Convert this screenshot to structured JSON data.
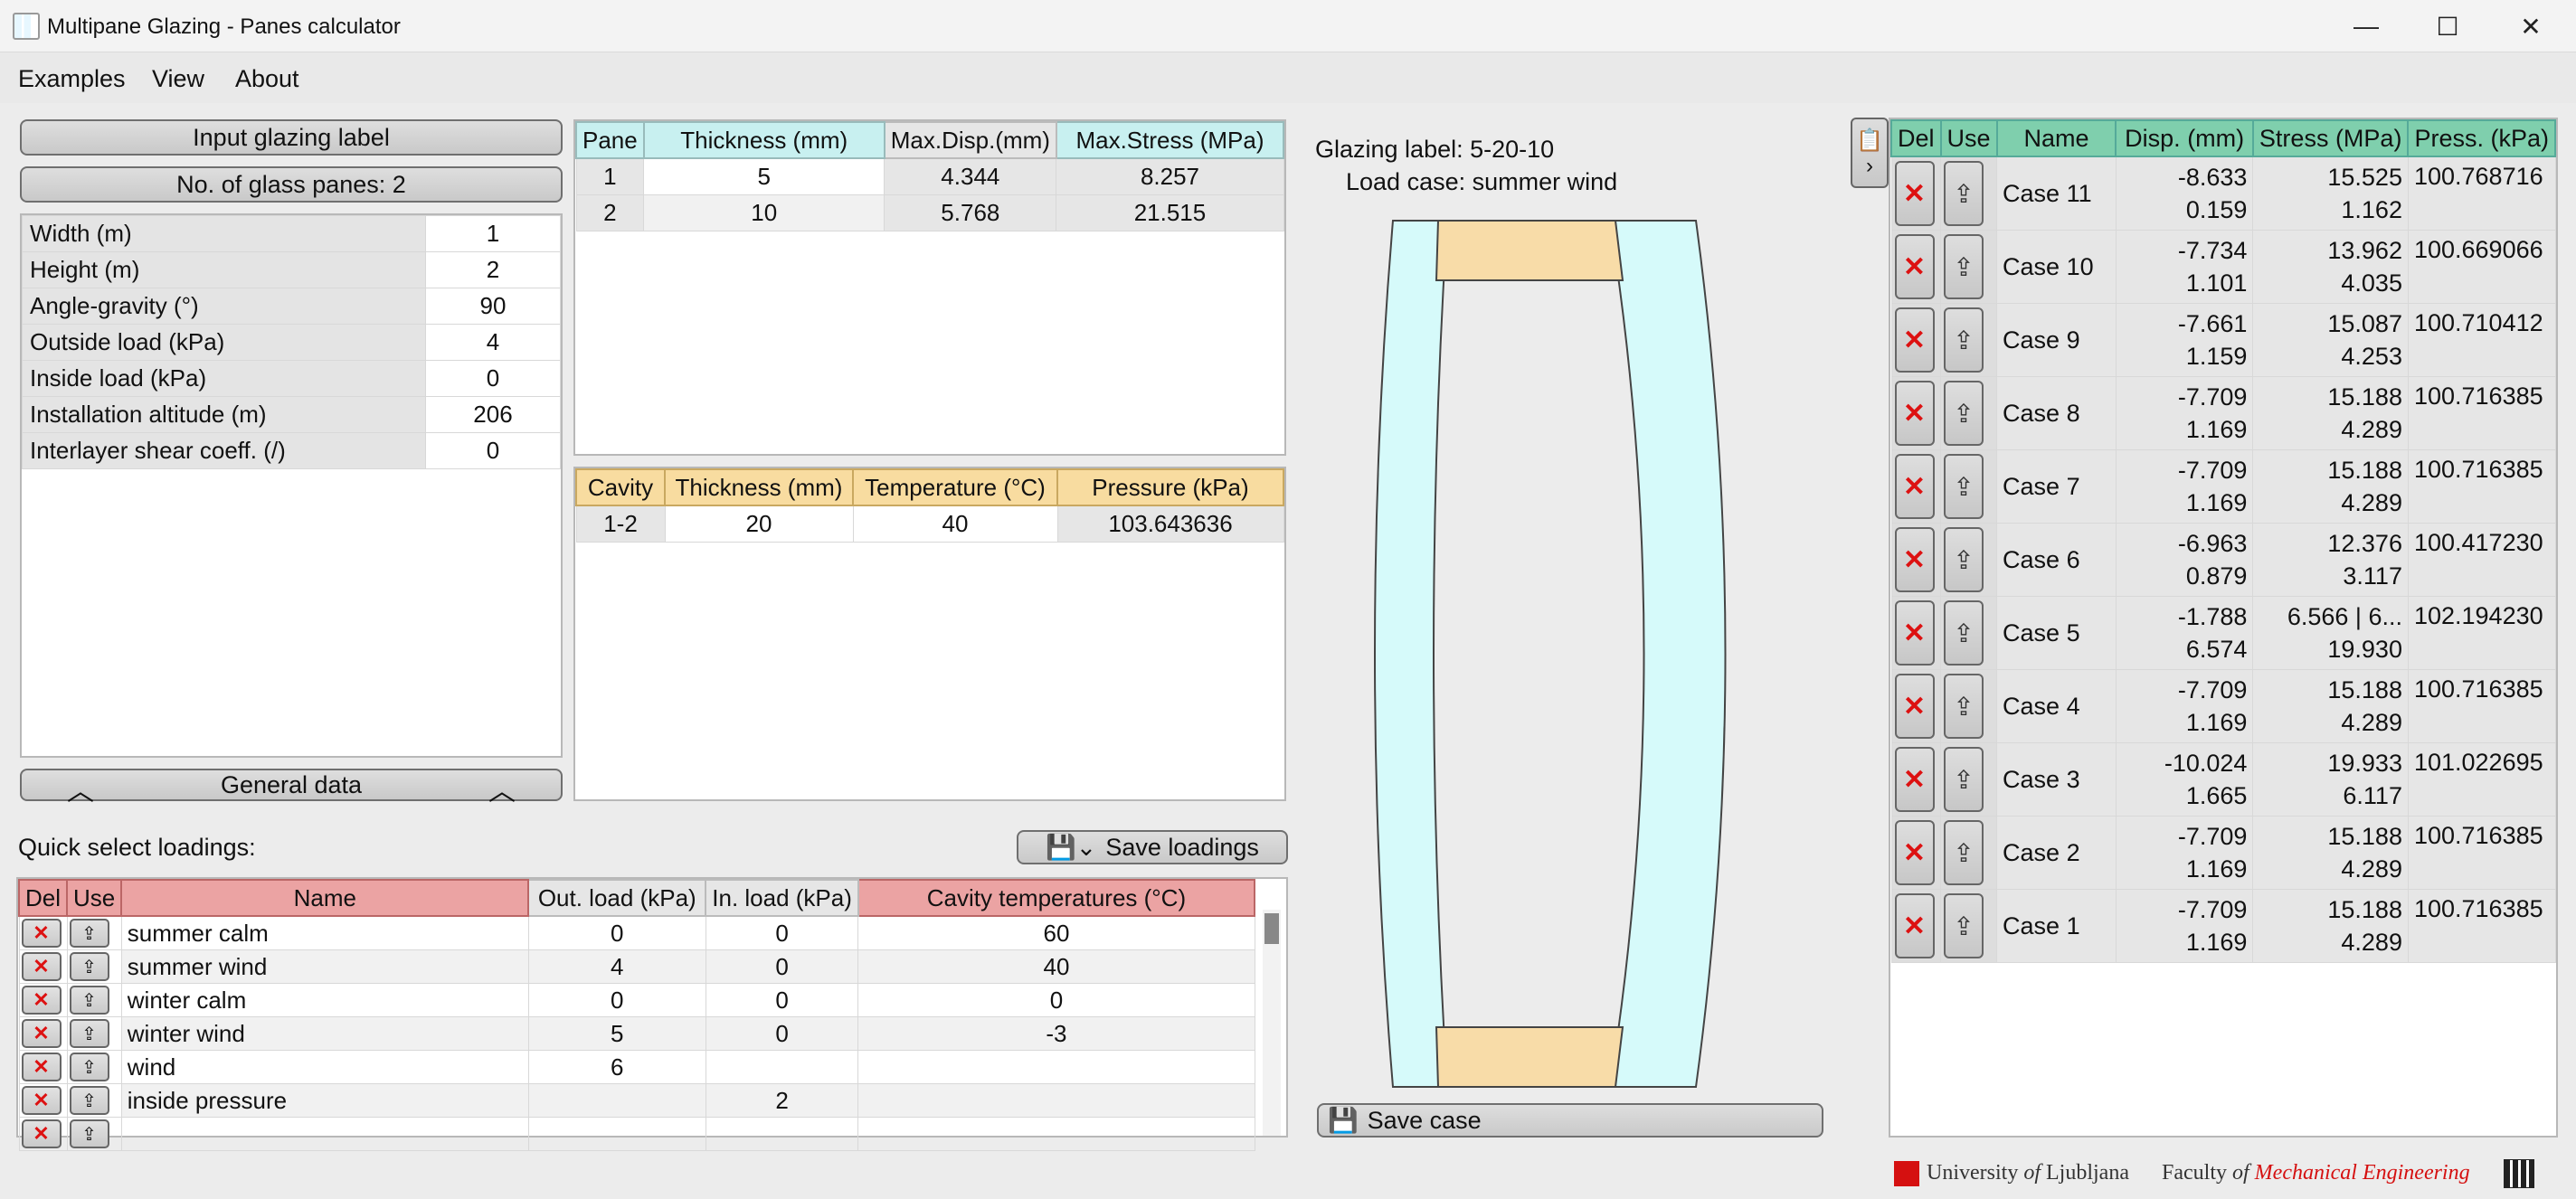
{
  "window": {
    "title": "Multipane Glazing - Panes calculator",
    "minimize": "—",
    "maximize": "☐",
    "close": "✕"
  },
  "menu": [
    "Examples",
    "View",
    "About"
  ],
  "left": {
    "label_button": "Input glazing label",
    "panes_button": "No. of glass panes: 2",
    "general_data_button": "General data",
    "general_data": [
      {
        "label": "Width (m)",
        "value": "1"
      },
      {
        "label": "Height (m)",
        "value": "2"
      },
      {
        "label": "Angle-gravity (°)",
        "value": "90"
      },
      {
        "label": "Outside load (kPa)",
        "value": "4"
      },
      {
        "label": "Inside load (kPa)",
        "value": "0"
      },
      {
        "label": "Installation altitude (m)",
        "value": "206"
      },
      {
        "label": "Interlayer shear coeff. (/)",
        "value": "0"
      }
    ]
  },
  "panes_table": {
    "headers": [
      "Pane",
      "Thickness (mm)",
      "Max.Disp.(mm)",
      "Max.Stress (MPa)"
    ],
    "rows": [
      [
        "1",
        "5",
        "4.344",
        "8.257"
      ],
      [
        "2",
        "10",
        "5.768",
        "21.515"
      ]
    ]
  },
  "cavity_table": {
    "headers": [
      "Cavity",
      "Thickness (mm)",
      "Temperature (°C)",
      "Pressure (kPa)"
    ],
    "rows": [
      [
        "1-2",
        "20",
        "40",
        "103.643636"
      ]
    ]
  },
  "drawing": {
    "glazing_label": "Glazing label: 5-20-10",
    "load_case": "Load case: summer wind",
    "save_case": "Save case"
  },
  "loadings": {
    "title": "Quick select loadings:",
    "save_button": "Save loadings",
    "headers": [
      "Del",
      "Use",
      "Name",
      "Out. load (kPa)",
      "In. load (kPa)",
      "Cavity temperatures (°C)"
    ],
    "rows": [
      [
        "summer calm",
        "0",
        "0",
        "60"
      ],
      [
        "summer wind",
        "4",
        "0",
        "40"
      ],
      [
        "winter calm",
        "0",
        "0",
        "0"
      ],
      [
        "winter wind",
        "5",
        "0",
        "-3"
      ],
      [
        "wind",
        "6",
        "",
        ""
      ],
      [
        "inside pressure",
        "",
        "2",
        ""
      ],
      [
        "",
        "",
        "",
        ""
      ]
    ]
  },
  "cases": {
    "headers": [
      "Del",
      "Use",
      "Name",
      "Disp. (mm)",
      "Stress (MPa)",
      "Press. (kPa)"
    ],
    "rows": [
      {
        "name": "Case 11",
        "disp1": "-8.633",
        "disp2": "0.159",
        "stress1": "15.525",
        "stress2": "1.162",
        "press": "100.768716"
      },
      {
        "name": "Case 10",
        "disp1": "-7.734",
        "disp2": "1.101",
        "stress1": "13.962",
        "stress2": "4.035",
        "press": "100.669066"
      },
      {
        "name": "Case 9",
        "disp1": "-7.661",
        "disp2": "1.159",
        "stress1": "15.087",
        "stress2": "4.253",
        "press": "100.710412"
      },
      {
        "name": "Case 8",
        "disp1": "-7.709",
        "disp2": "1.169",
        "stress1": "15.188",
        "stress2": "4.289",
        "press": "100.716385"
      },
      {
        "name": "Case 7",
        "disp1": "-7.709",
        "disp2": "1.169",
        "stress1": "15.188",
        "stress2": "4.289",
        "press": "100.716385"
      },
      {
        "name": "Case 6",
        "disp1": "-6.963",
        "disp2": "0.879",
        "stress1": "12.376",
        "stress2": "3.117",
        "press": "100.417230"
      },
      {
        "name": "Case 5",
        "disp1": "-1.788",
        "disp2": "6.574",
        "stress1": "6.566 | 6...",
        "stress2": "19.930",
        "press": "102.194230"
      },
      {
        "name": "Case 4",
        "disp1": "-7.709",
        "disp2": "1.169",
        "stress1": "15.188",
        "stress2": "4.289",
        "press": "100.716385"
      },
      {
        "name": "Case 3",
        "disp1": "-10.024",
        "disp2": "1.665",
        "stress1": "19.933",
        "stress2": "6.117",
        "press": "101.022695"
      },
      {
        "name": "Case 2",
        "disp1": "-7.709",
        "disp2": "1.169",
        "stress1": "15.188",
        "stress2": "4.289",
        "press": "100.716385"
      },
      {
        "name": "Case 1",
        "disp1": "-7.709",
        "disp2": "1.169",
        "stress1": "15.188",
        "stress2": "4.289",
        "press": "100.716385"
      }
    ]
  },
  "footer": {
    "university": "University of Ljubljana",
    "faculty": "Faculty of Mechanical Engineering"
  },
  "colors": {
    "glass": "#d6fafa",
    "spacer": "#f8dca8",
    "accent_red": "#cc1111"
  }
}
